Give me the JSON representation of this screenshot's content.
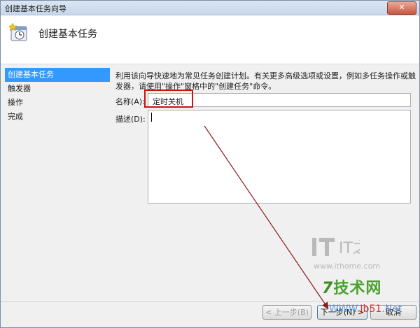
{
  "window": {
    "title": "创建基本任务向导",
    "close_label": "✕"
  },
  "header": {
    "title": "创建基本任务",
    "icon": "task-scheduler-icon"
  },
  "nav": {
    "items": [
      {
        "label": "创建基本任务",
        "active": true
      },
      {
        "label": "触发器",
        "active": false
      },
      {
        "label": "操作",
        "active": false
      },
      {
        "label": "完成",
        "active": false
      }
    ]
  },
  "form": {
    "description": "利用该向导快速地为常见任务创建计划。有关更多高级选项或设置，例如多任务操作或触发器，请使用\"操作\"窗格中的\"创建任务\"命令。",
    "name_label": "名称(A):",
    "name_value": "定时关机",
    "desc_label": "描述(D):",
    "desc_value": ""
  },
  "buttons": {
    "back": "< 上一步(B)",
    "next": "下一步(N) >",
    "cancel": "取消"
  },
  "watermark": {
    "it_logo": "IT之家",
    "ithome": "www.ithome.com",
    "jsw_prefix": "7",
    "jsw": "技术网",
    "url_a": "WWW.",
    "url_b": "Jb51",
    "url_c": ".Net"
  },
  "colors": {
    "highlight": "#cc1111",
    "arrow": "#8b1a1a",
    "selection": "#3399ff"
  }
}
